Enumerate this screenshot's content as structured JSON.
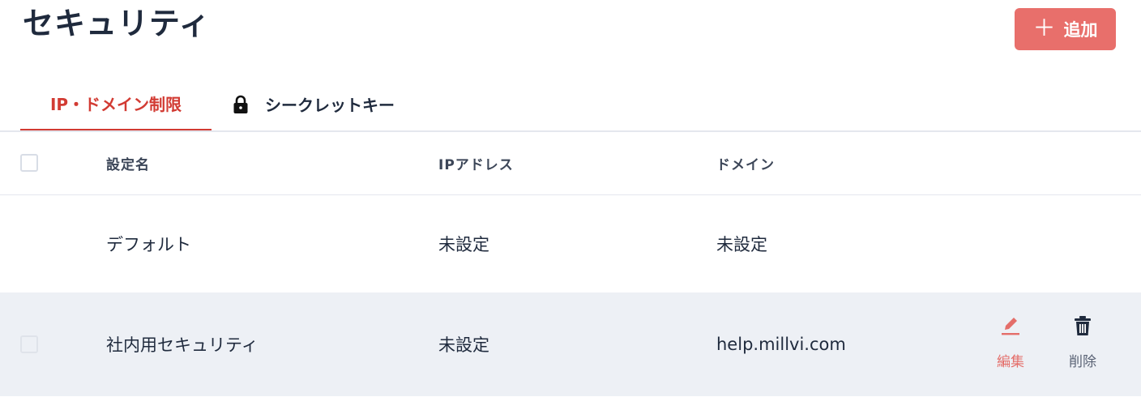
{
  "page": {
    "title": "セキュリティ"
  },
  "header": {
    "add_button_label": "追加"
  },
  "tabs": [
    {
      "label": "IP・ドメイン制限",
      "active": true
    },
    {
      "label": "シークレットキー",
      "active": false,
      "icon": "lock-icon"
    }
  ],
  "table": {
    "columns": [
      "設定名",
      "IPアドレス",
      "ドメイン"
    ],
    "rows": [
      {
        "name": "デフォルト",
        "ip": "未設定",
        "domain": "未設定",
        "checkbox": false
      },
      {
        "name": "社内用セキュリティ",
        "ip": "未設定",
        "domain": "help.millvi.com",
        "checkbox": true,
        "actions": {
          "edit_label": "編集",
          "edit_icon": "pencil-icon",
          "delete_label": "削除",
          "delete_icon": "trash-icon"
        }
      }
    ]
  },
  "colors": {
    "accent": "#e86f6b",
    "active_tab": "#d23b33",
    "text": "#1f2a3d",
    "row_highlight": "#edf0f5"
  }
}
